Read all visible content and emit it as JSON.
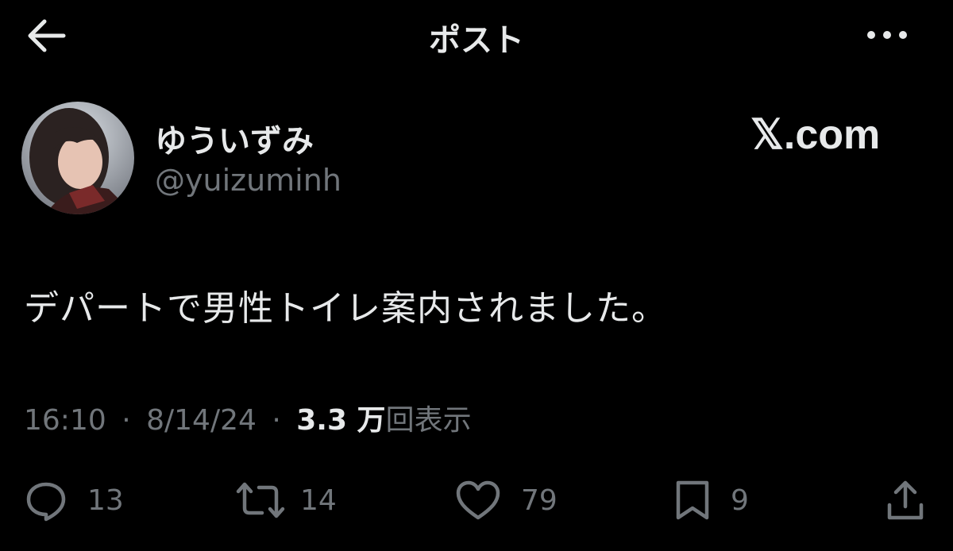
{
  "header": {
    "title": "ポスト"
  },
  "user": {
    "display_name": "ゆういずみ",
    "handle": "@yuizuminh"
  },
  "watermark": "𝕏.com",
  "post": {
    "text": "デパートで男性トイレ案内されました。",
    "time": "16:10",
    "separator": "·",
    "date": "8/14/24",
    "views_count": "3.3 万",
    "views_label": "回表示"
  },
  "actions": {
    "replies": "13",
    "reposts": "14",
    "likes": "79",
    "bookmarks": "9"
  },
  "colors": {
    "background": "#000000",
    "primary_text": "#e7e9ea",
    "secondary_text": "#71767b"
  },
  "icons": [
    "back-arrow-icon",
    "more-icon",
    "reply-icon",
    "repost-icon",
    "like-icon",
    "bookmark-icon",
    "share-icon"
  ]
}
